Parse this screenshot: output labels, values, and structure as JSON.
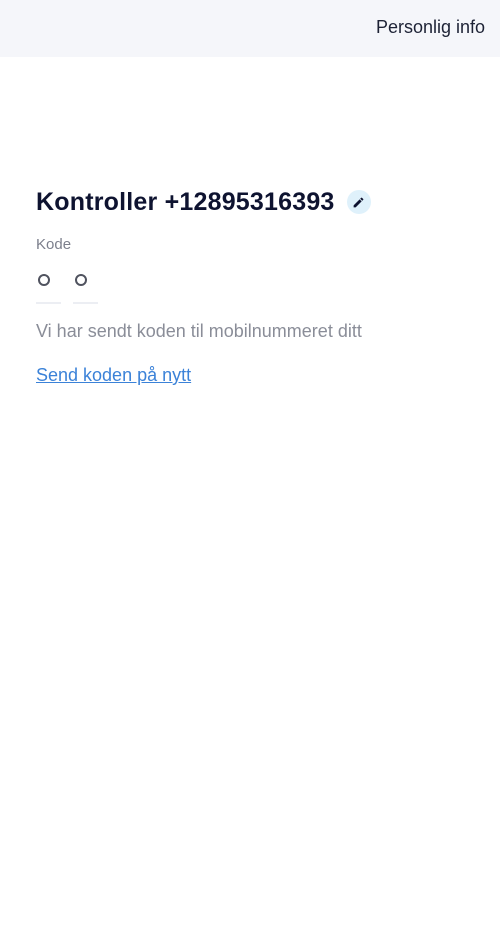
{
  "header": {
    "title": "Personlig info"
  },
  "verify": {
    "heading": "Kontroller +12895316393",
    "edit_icon": "pencil-icon",
    "code_label": "Kode",
    "code_length": 2,
    "info_text": "Vi har sendt koden til mobilnummeret ditt",
    "resend_link": "Send koden på nytt"
  },
  "colors": {
    "accent_link": "#3b82d8",
    "edit_button_bg": "#dff1fb",
    "heading": "#0e1330",
    "topbar_bg": "#f5f6fa"
  }
}
